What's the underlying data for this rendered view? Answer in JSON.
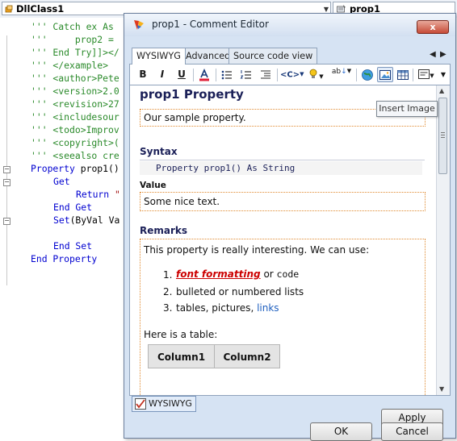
{
  "ide": {
    "class_combo": "DllClass1",
    "member_combo": "prop1",
    "code_lines": [
      {
        "text": "''' Catch ex As",
        "kind": "cmt"
      },
      {
        "text": "'''     prop2 =",
        "kind": "cmt"
      },
      {
        "text": "''' End Try]]></",
        "kind": "cmt"
      },
      {
        "text": "''' </example>",
        "kind": "cmt"
      },
      {
        "text": "''' <author>Pete",
        "kind": "cmt"
      },
      {
        "text": "''' <version>2.0",
        "kind": "cmt"
      },
      {
        "text": "''' <revision>27",
        "kind": "cmt"
      },
      {
        "text": "''' <includesour",
        "kind": "cmt"
      },
      {
        "text": "''' <todo>Improv",
        "kind": "cmt"
      },
      {
        "text": "''' <copyright>(",
        "kind": "cmt"
      },
      {
        "text": "''' <seealso cre",
        "kind": "cmt"
      }
    ],
    "code_kw": {
      "property": "Property",
      "prop_name": " prop1()",
      "get": "Get",
      "return": "Return",
      "return_str": " \"",
      "end_get": "End Get",
      "set": "Set",
      "set_args": "(ByVal",
      "set_va": " Va",
      "end_set": "End Set",
      "end_property": "End Property"
    }
  },
  "window": {
    "title": "prop1 - Comment Editor",
    "close_label": "x"
  },
  "tabs": [
    "WYSIWYG",
    "Advanced",
    "Source code view"
  ],
  "toolbar": {
    "bold": "B",
    "italic": "I",
    "underline": "U",
    "code_label": "<C>",
    "spell_label": "ab"
  },
  "tooltip": "Insert Image",
  "doc": {
    "heading": "prop1 Property",
    "summary": "Our sample property.",
    "syntax_heading": "Syntax",
    "syntax_code": "Property prop1() As String",
    "value_label": "Value",
    "value_text": "Some nice text.",
    "remarks_heading": "Remarks",
    "remarks_intro": "This property is really interesting. We can use:",
    "list": {
      "n1": "1.",
      "n2": "2.",
      "n3": "3.",
      "item1_fmt": "font formatting",
      "item1_or": " or ",
      "item1_code": "code",
      "item2": "bulleted or numbered lists",
      "item3_text": "tables, pictures, ",
      "item3_link": "links"
    },
    "table_intro": "Here is a table:",
    "table_headers": [
      "Column1",
      "Column2"
    ]
  },
  "bottom": {
    "wysiwyg_toggle": "WYSIWYG",
    "apply": "Apply",
    "ok": "OK",
    "cancel": "Cancel"
  },
  "colors": {
    "comment": "#2a8a2a",
    "keyword": "#0000d0",
    "heading": "#1b2058",
    "link": "#1f5fbf",
    "accent_red": "#cc0000"
  }
}
